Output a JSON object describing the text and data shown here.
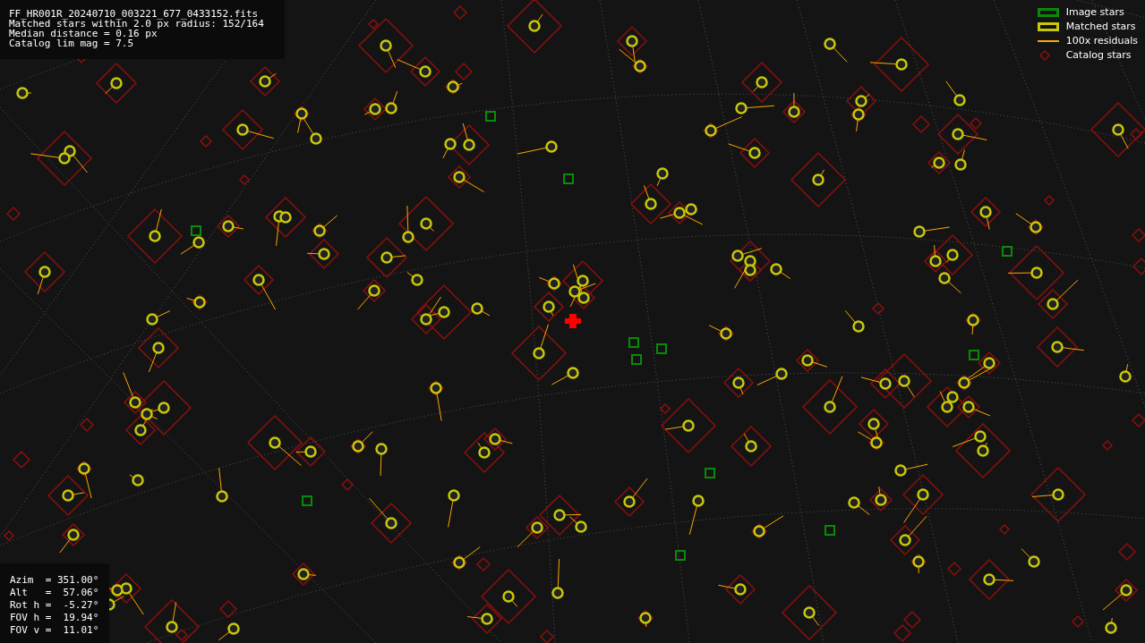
{
  "info_box": {
    "lines": [
      "FF_HR001R_20240710_003221_677_0433152.fits",
      "Matched stars within 2.0 px radius: 152/164",
      "Median distance = 0.16 px",
      "Catalog lim mag = 7.5"
    ]
  },
  "legend": [
    {
      "label": "Image stars",
      "kind": "rect",
      "color": "#0a8a0a"
    },
    {
      "label": "Matched stars",
      "kind": "rect",
      "color": "#c8c80a"
    },
    {
      "label": "100x residuals",
      "kind": "line",
      "color": "#ffa500"
    },
    {
      "label": "Catalog stars",
      "kind": "none"
    }
  ],
  "pointing": {
    "lines": [
      "Azim  = 351.00°",
      "Alt   =  57.06°",
      "Rot h =  -5.27°",
      "FOV h =  19.94°",
      "FOV v =  11.01°"
    ]
  }
}
